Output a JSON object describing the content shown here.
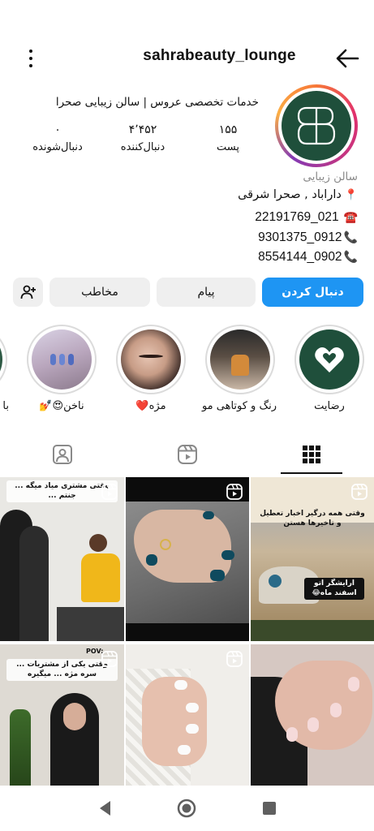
{
  "header": {
    "username": "sahrabeauty_lounge"
  },
  "profile": {
    "bio_top": "خدمات تخصصی عروس | سالن زیبایی صحرا",
    "stats": [
      {
        "value": "۱۵۵",
        "label": "پست"
      },
      {
        "value": "۴٬۴۵۲",
        "label": "دنبال‌کننده"
      },
      {
        "value": "۰",
        "label": "دنبال‌شونده"
      }
    ],
    "avatar_letters": "SB",
    "category": "سالن زیبایی",
    "location": "داراباد , صحرا شرقی",
    "phones": [
      "22191769_021",
      "9301375_0912",
      "8554144_0902"
    ]
  },
  "buttons": {
    "follow": "دنبال کردن",
    "message": "پیام",
    "contact": "مخاطب"
  },
  "highlights": [
    {
      "label": "رضایت"
    },
    {
      "label": "رنگ و کوتاهی مو"
    },
    {
      "label": "مژه❤️"
    },
    {
      "label": "ناخن😍💅"
    },
    {
      "label": "با"
    }
  ],
  "grid": {
    "captions": {
      "p1": "وقتی همه درگیر اخبار تعطیل و تاخیرها هستن",
      "p1_inner": "ارایشگر اتو اسفند ماه😂",
      "p3": "وقتی مشتری میاد میگه ... جنتم ...",
      "p4": "وقتی یکی از مشتریات ... سره مژه ... میگیره",
      "p4_badge": "POV:"
    }
  },
  "colors": {
    "follow_button": "#1e95f3",
    "secondary_button": "#efefef",
    "avatar_bg": "#1f4f3b"
  }
}
